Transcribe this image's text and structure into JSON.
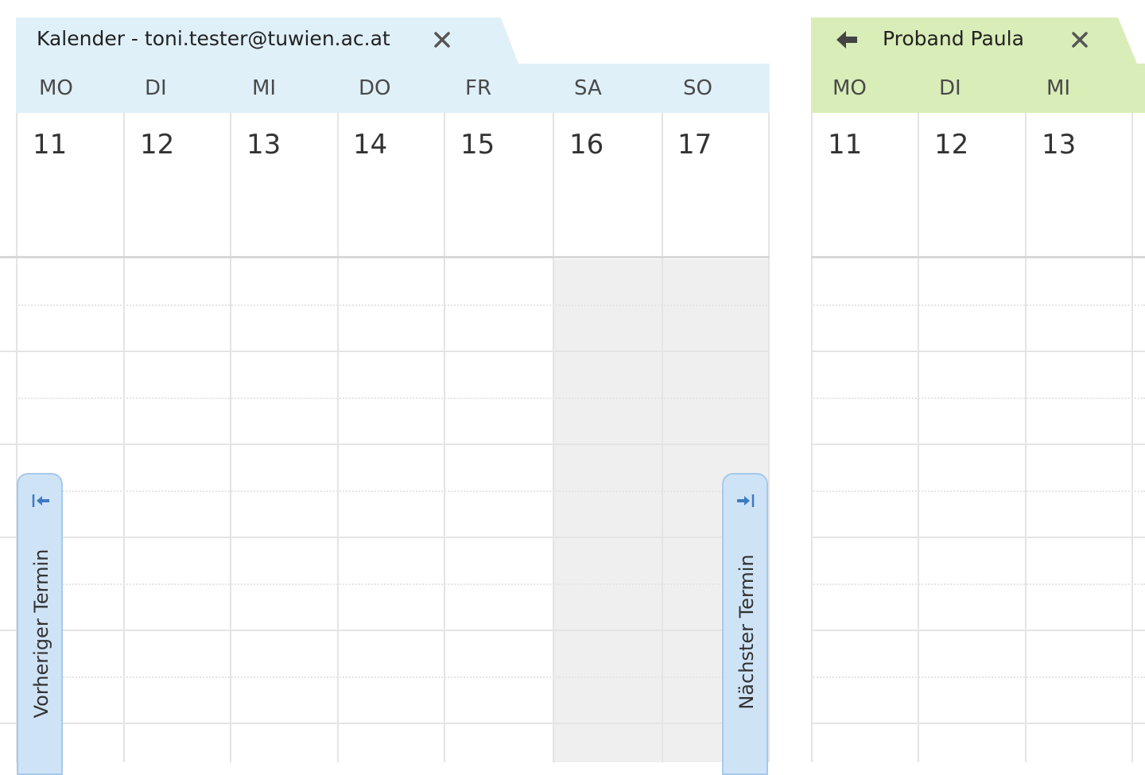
{
  "own_calendar": {
    "tab_title": "Kalender - toni.tester@tuwien.ac.at",
    "weekdays": [
      "MO",
      "DI",
      "MI",
      "DO",
      "FR",
      "SA",
      "SO"
    ],
    "dates": [
      "11",
      "12",
      "13",
      "14",
      "15",
      "16",
      "17"
    ],
    "prev_label": "Vorheriger Termin",
    "next_label": "Nächster Termin",
    "header_color": "#e0f0f9"
  },
  "shared_calendar": {
    "tab_title": "Proband Paula",
    "weekdays": [
      "MO",
      "DI",
      "MI"
    ],
    "dates": [
      "11",
      "12",
      "13"
    ],
    "header_color": "#d9edb8"
  },
  "icons": {
    "close": "close-icon",
    "back": "arrow-left-icon",
    "prev": "arrow-left-to-bar-icon",
    "next": "arrow-right-to-bar-icon"
  }
}
